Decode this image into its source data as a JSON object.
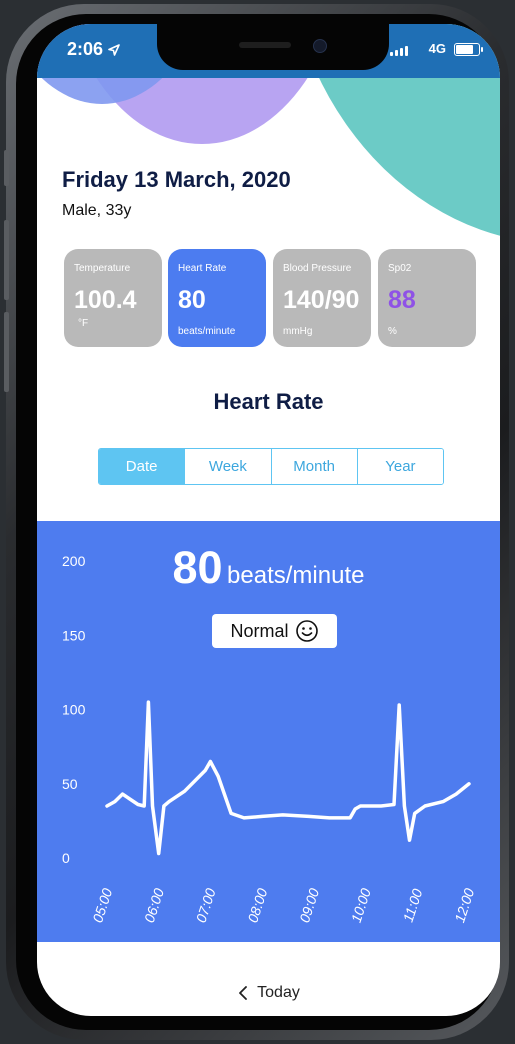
{
  "status": {
    "time": "2:06",
    "network": "4G"
  },
  "header": {
    "date": "Friday 13 March, 2020",
    "subtitle": "Male, 33y"
  },
  "cards": [
    {
      "label": "Temperature",
      "value": "100.4",
      "unit": "°F"
    },
    {
      "label": "Heart Rate",
      "value": "80",
      "unit": "beats/minute",
      "active": true
    },
    {
      "label": "Blood Pressure",
      "value": "140/90",
      "unit": "mmHg"
    },
    {
      "label": "Sp02",
      "value": "88",
      "unit": "%"
    }
  ],
  "section_title": "Heart Rate",
  "range_tabs": [
    "Date",
    "Week",
    "Month",
    "Year"
  ],
  "selected_tab": "Date",
  "reading": {
    "value": "80",
    "unit": "beats/minute",
    "status": "Normal"
  },
  "colors": {
    "panel": "#4e7cef",
    "card_active": "#4c7cf0",
    "card_inactive": "#b9b9b9",
    "teal": "#6ccbc6",
    "spo2": "#8f52e6"
  },
  "footer": {
    "label": "Today"
  },
  "chart_data": {
    "type": "line",
    "ylim": [
      0,
      200
    ],
    "y_ticks": [
      0,
      50,
      100,
      150,
      200
    ],
    "x_ticks": [
      "05:00",
      "06:00",
      "07:00",
      "08:00",
      "09:00",
      "10:00",
      "11:00",
      "12:00"
    ],
    "series": [
      {
        "x": [
          5.0,
          5.15,
          5.3,
          5.6,
          5.72,
          5.8,
          5.88,
          6.0,
          6.1,
          6.2,
          6.5,
          6.9,
          7.0,
          7.15,
          7.4,
          7.65,
          8.0,
          8.4,
          8.9,
          9.3,
          9.7,
          9.8,
          9.9,
          10.3,
          10.55,
          10.65,
          10.75,
          10.85,
          10.95,
          11.15,
          11.5,
          11.75,
          12.0
        ],
        "y": [
          35,
          38,
          43,
          36,
          35,
          105,
          35,
          3,
          35,
          38,
          45,
          59,
          65,
          55,
          30,
          27,
          28,
          29,
          28,
          27,
          27,
          33,
          35,
          35,
          36,
          103,
          35,
          12,
          30,
          35,
          38,
          43,
          50
        ]
      }
    ]
  }
}
